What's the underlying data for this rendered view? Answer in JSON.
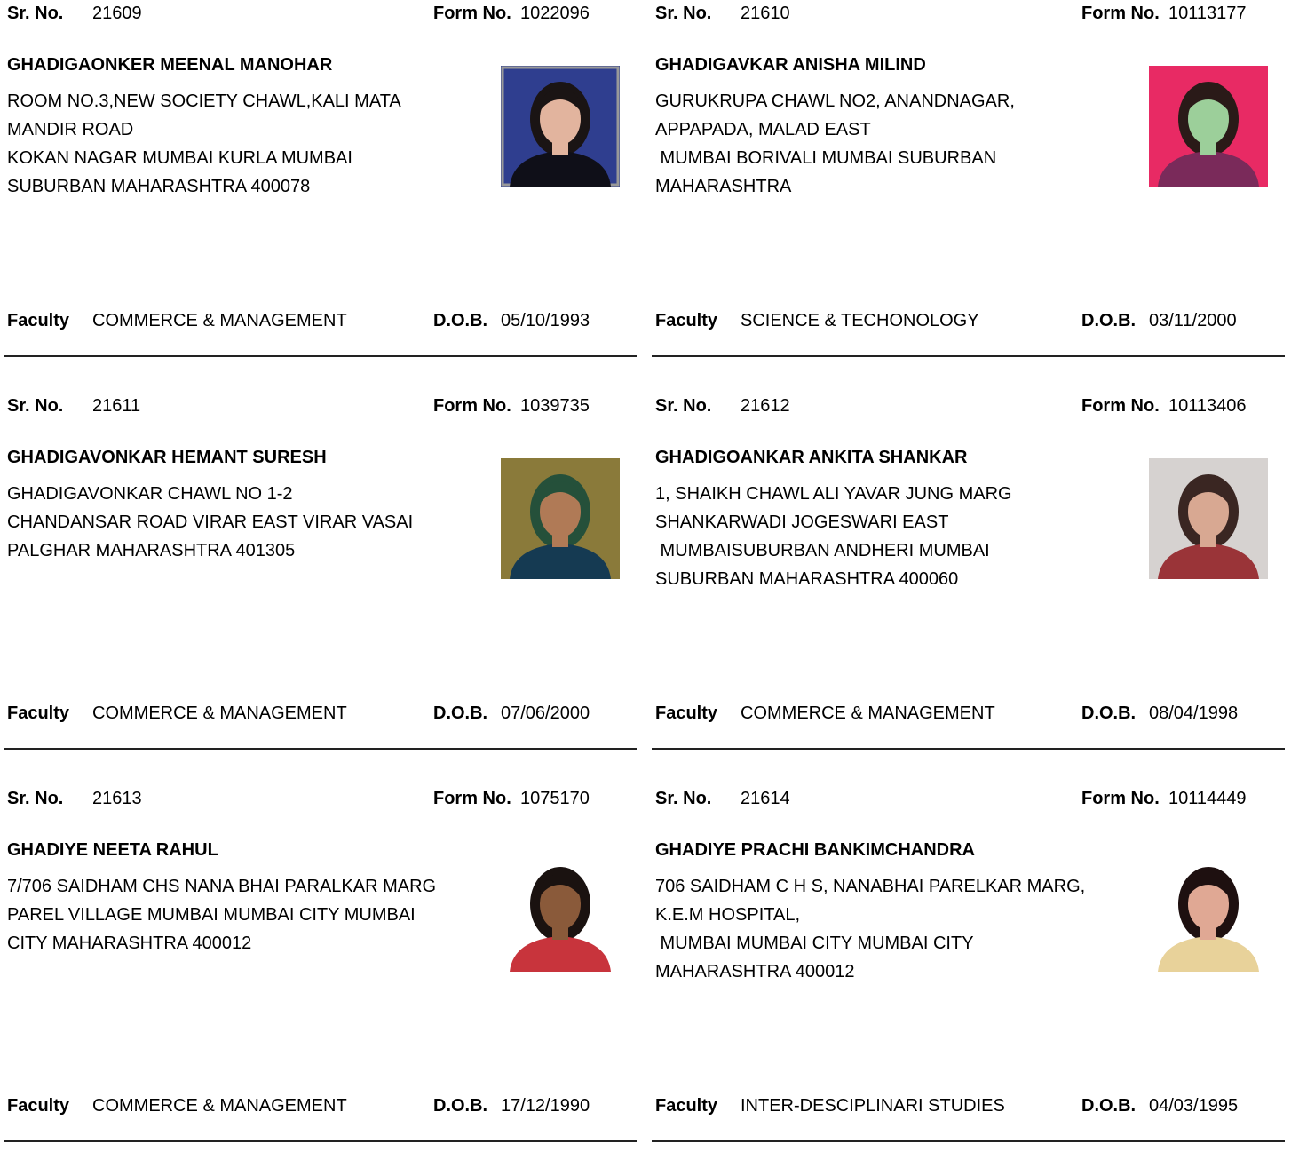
{
  "labels": {
    "sr_no": "Sr. No.",
    "form_no": "Form No.",
    "faculty": "Faculty",
    "dob": "D.O.B."
  },
  "records": [
    {
      "sr_no": "21609",
      "form_no": "1022096",
      "name": "GHADIGAONKER MEENAL MANOHAR",
      "address_lines": [
        "ROOM NO.3,NEW SOCIETY CHAWL,KALI MATA",
        "MANDIR ROAD",
        "KOKAN NAGAR MUMBAI KURLA MUMBAI",
        "SUBURBAN MAHARASHTRA 400078"
      ],
      "faculty": "COMMERCE & MANAGEMENT",
      "dob": "05/10/1993",
      "photo_palette": {
        "bg": "#2f3e8f",
        "skin": "#e2b49e",
        "hair": "#1a1414",
        "cloth": "#0f0f18"
      }
    },
    {
      "sr_no": "21610",
      "form_no": "10113177",
      "name": "GHADIGAVKAR ANISHA MILIND",
      "address_lines": [
        "GURUKRUPA CHAWL NO2, ANANDNAGAR,",
        "APPAPADA, MALAD EAST",
        " MUMBAI BORIVALI MUMBAI SUBURBAN",
        "MAHARASHTRA"
      ],
      "faculty": "SCIENCE & TECHONOLOGY",
      "dob": "03/11/2000",
      "photo_palette": {
        "bg": "#e82a64",
        "skin": "#9ccf9a",
        "hair": "#2a1a18",
        "cloth": "#7a2a5a"
      }
    },
    {
      "sr_no": "21611",
      "form_no": "1039735",
      "name": "GHADIGAVONKAR HEMANT SURESH",
      "address_lines": [
        "GHADIGAVONKAR CHAWL NO 1-2",
        "CHANDANSAR ROAD VIRAR EAST VIRAR VASAI",
        "PALGHAR MAHARASHTRA 401305"
      ],
      "faculty": "COMMERCE & MANAGEMENT",
      "dob": "07/06/2000",
      "photo_palette": {
        "bg": "#8a7a3a",
        "skin": "#b07a56",
        "hair": "#25503a",
        "cloth": "#153a52"
      }
    },
    {
      "sr_no": "21612",
      "form_no": "10113406",
      "name": "GHADIGOANKAR ANKITA SHANKAR",
      "address_lines": [
        "1, SHAIKH CHAWL ALI YAVAR JUNG MARG",
        "SHANKARWADI JOGESWARI EAST",
        " MUMBAISUBURBAN ANDHERI MUMBAI",
        "SUBURBAN MAHARASHTRA 400060"
      ],
      "faculty": "COMMERCE & MANAGEMENT",
      "dob": "08/04/1998",
      "photo_palette": {
        "bg": "#d6d2d0",
        "skin": "#d8a892",
        "hair": "#3a2622",
        "cloth": "#9a3438"
      }
    },
    {
      "sr_no": "21613",
      "form_no": "1075170",
      "name": "GHADIYE NEETA RAHUL",
      "address_lines": [
        "7/706 SAIDHAM CHS NANA BHAI PARALKAR MARG",
        "PAREL VILLAGE MUMBAI MUMBAI CITY MUMBAI",
        "CITY MAHARASHTRA 400012"
      ],
      "faculty": "COMMERCE & MANAGEMENT",
      "dob": "17/12/1990",
      "photo_palette": {
        "bg": "#ffffff",
        "skin": "#8a5a3a",
        "hair": "#1a1210",
        "cloth": "#c8343c"
      }
    },
    {
      "sr_no": "21614",
      "form_no": "10114449",
      "name": "GHADIYE PRACHI BANKIMCHANDRA",
      "address_lines": [
        "706 SAIDHAM C H S, NANABHAI PARELKAR MARG,",
        "K.E.M HOSPITAL,",
        " MUMBAI MUMBAI CITY MUMBAI CITY",
        "MAHARASHTRA 400012"
      ],
      "faculty": "INTER-DESCIPLINARI STUDIES",
      "dob": "04/03/1995",
      "photo_palette": {
        "bg": "#ffffff",
        "skin": "#e0a894",
        "hair": "#1e1010",
        "cloth": "#e8d29a"
      }
    }
  ]
}
